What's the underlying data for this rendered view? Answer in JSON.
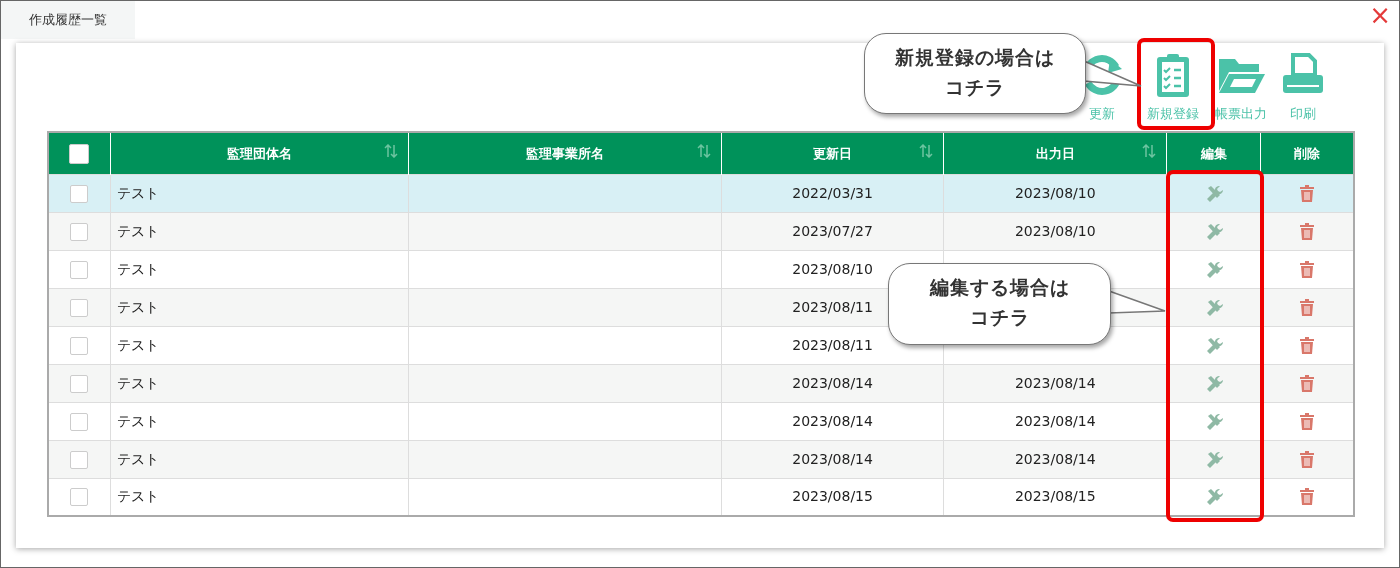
{
  "window": {
    "title": "作成履歴一覧",
    "close": "×"
  },
  "toolbar": [
    {
      "kind": "refresh",
      "label": "更新"
    },
    {
      "kind": "new",
      "label": "新規登録"
    },
    {
      "kind": "folder",
      "label": "帳票出力"
    },
    {
      "kind": "print",
      "label": "印刷"
    }
  ],
  "table": {
    "columns": [
      {
        "kind": "check",
        "checked": false
      },
      {
        "label": "監理団体名",
        "sortable": true
      },
      {
        "label": "監理事業所名",
        "sortable": true
      },
      {
        "label": "更新日",
        "sortable": true
      },
      {
        "label": "出力日",
        "sortable": true
      },
      {
        "label": "編集",
        "sortable": false
      },
      {
        "label": "削除",
        "sortable": false
      }
    ],
    "rows": [
      {
        "selected": true,
        "checked": false,
        "group": "テスト",
        "updated": "2022/03/31",
        "output": "2023/08/10"
      },
      {
        "selected": false,
        "checked": false,
        "group": "テスト",
        "updated": "2023/07/27",
        "output": "2023/08/10"
      },
      {
        "selected": false,
        "checked": false,
        "group": "テスト",
        "updated": "2023/08/10"
      },
      {
        "selected": false,
        "checked": false,
        "group": "テスト",
        "updated": "2023/08/11"
      },
      {
        "selected": false,
        "checked": false,
        "group": "テスト",
        "updated": "2023/08/11"
      },
      {
        "selected": false,
        "checked": false,
        "group": "テスト",
        "updated": "2023/08/14",
        "output": "2023/08/14"
      },
      {
        "selected": false,
        "checked": false,
        "group": "テスト",
        "updated": "2023/08/14",
        "output": "2023/08/14"
      },
      {
        "selected": false,
        "checked": false,
        "group": "テスト",
        "updated": "2023/08/14",
        "output": "2023/08/14"
      },
      {
        "selected": false,
        "checked": false,
        "group": "テスト",
        "updated": "2023/08/15",
        "output": "2023/08/15"
      }
    ]
  },
  "callouts": [
    {
      "lines": [
        "新規登録の場合は",
        "コチラ"
      ]
    },
    {
      "lines": [
        "編集する場合は",
        "コチラ"
      ]
    }
  ]
}
